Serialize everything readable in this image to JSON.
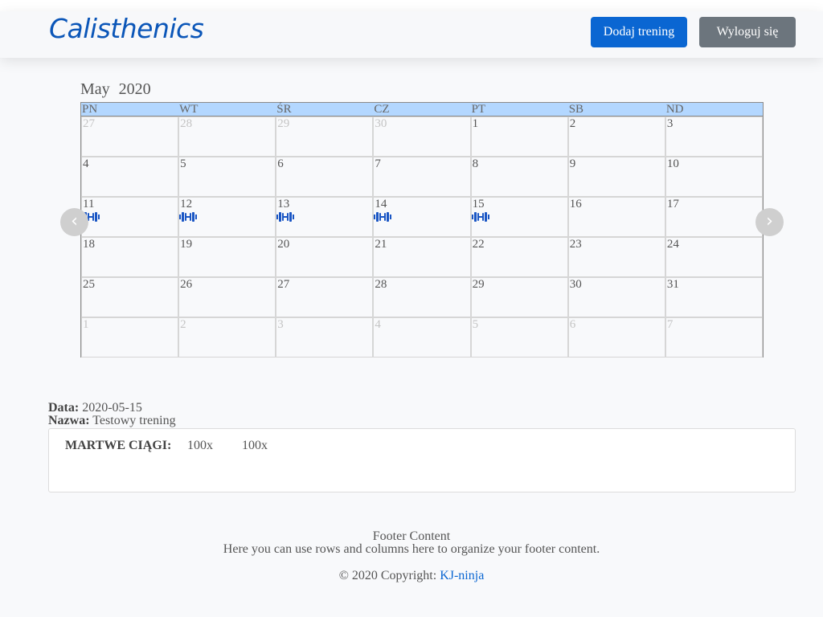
{
  "navbar": {
    "brand": "Calisthenics",
    "add_training_label": "Dodaj trening",
    "logout_label": "Wyloguj się"
  },
  "calendar": {
    "month": "May",
    "year": "2020",
    "weekdays": [
      "PN",
      "WT",
      "ŚR",
      "CZ",
      "PT",
      "SB",
      "ND"
    ],
    "weeks": [
      [
        {
          "day": "27",
          "muted": true
        },
        {
          "day": "28",
          "muted": true
        },
        {
          "day": "29",
          "muted": true
        },
        {
          "day": "30",
          "muted": true
        },
        {
          "day": "1"
        },
        {
          "day": "2"
        },
        {
          "day": "3"
        }
      ],
      [
        {
          "day": "4"
        },
        {
          "day": "5"
        },
        {
          "day": "6"
        },
        {
          "day": "7"
        },
        {
          "day": "8"
        },
        {
          "day": "9"
        },
        {
          "day": "10"
        }
      ],
      [
        {
          "day": "11",
          "workout": true
        },
        {
          "day": "12",
          "workout": true
        },
        {
          "day": "13",
          "workout": true
        },
        {
          "day": "14",
          "workout": true
        },
        {
          "day": "15",
          "workout": true
        },
        {
          "day": "16"
        },
        {
          "day": "17"
        }
      ],
      [
        {
          "day": "18"
        },
        {
          "day": "19"
        },
        {
          "day": "20"
        },
        {
          "day": "21"
        },
        {
          "day": "22"
        },
        {
          "day": "23"
        },
        {
          "day": "24"
        }
      ],
      [
        {
          "day": "25"
        },
        {
          "day": "26"
        },
        {
          "day": "27"
        },
        {
          "day": "28"
        },
        {
          "day": "29"
        },
        {
          "day": "30"
        },
        {
          "day": "31"
        }
      ],
      [
        {
          "day": "1",
          "muted": true
        },
        {
          "day": "2",
          "muted": true
        },
        {
          "day": "3",
          "muted": true
        },
        {
          "day": "4",
          "muted": true
        },
        {
          "day": "5",
          "muted": true
        },
        {
          "day": "6",
          "muted": true
        },
        {
          "day": "7",
          "muted": true
        }
      ]
    ],
    "prev_icon": "chevron-left-icon",
    "next_icon": "chevron-right-icon",
    "workout_icon": "dumbbell-icon",
    "workout_icon_color": "#1a56c4"
  },
  "details": {
    "date_label": "Data:",
    "date_value": "2020-05-15",
    "name_label": "Nazwa:",
    "name_value": "Testowy trening",
    "exercise": {
      "name": "MARTWE CIĄGI:",
      "reps": [
        "100x",
        "100x"
      ]
    }
  },
  "footer": {
    "title": "Footer Content",
    "text": "Here you can use rows and columns here to organize your footer content.",
    "copyright_prefix": "© 2020 Copyright:",
    "copyright_link": "KJ-ninja"
  }
}
